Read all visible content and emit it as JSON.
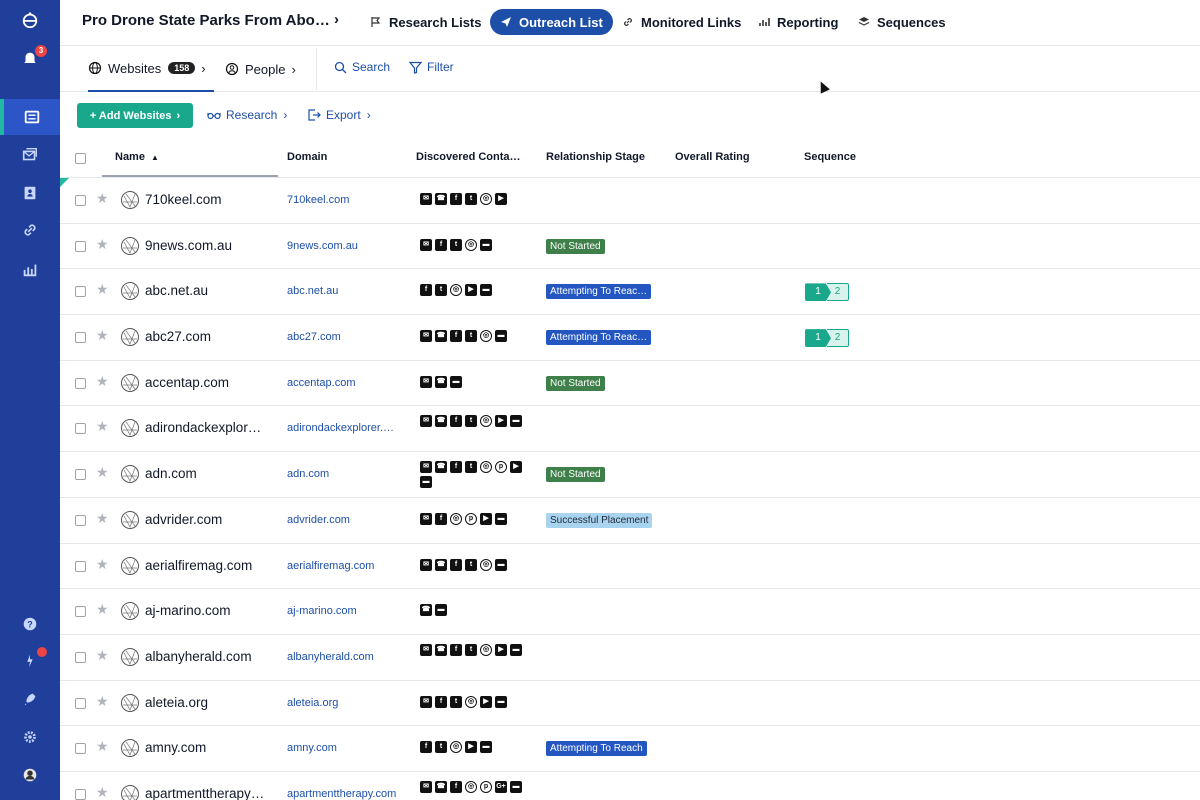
{
  "rail": {
    "notification_count": "3"
  },
  "topbar": {
    "project_title": "Pro Drone State Parks From Abo…",
    "nav": [
      {
        "label": "Research Lists",
        "icon": "flag-icon"
      },
      {
        "label": "Outreach List",
        "icon": "send-icon",
        "active": true
      },
      {
        "label": "Monitored Links",
        "icon": "link-icon"
      },
      {
        "label": "Reporting",
        "icon": "bar-chart-icon"
      },
      {
        "label": "Sequences",
        "icon": "layers-icon"
      }
    ]
  },
  "subbar": {
    "websites_label": "Websites",
    "websites_count": "158",
    "people_label": "People",
    "search_label": "Search",
    "filter_label": "Filter"
  },
  "actions": {
    "add_websites": "+ Add Websites",
    "research": "Research",
    "export": "Export"
  },
  "table": {
    "columns": [
      "Name",
      "Domain",
      "Discovered Conta…",
      "Relationship Stage",
      "Overall Rating",
      "Sequence"
    ],
    "sort_indicator": "▲",
    "rows": [
      {
        "name": "710keel.com",
        "domain": "710keel.com",
        "contacts": [
          "email",
          "phone",
          "facebook",
          "twitter",
          "instagram",
          "youtube"
        ],
        "stage": "",
        "stage_type": "",
        "seq": null
      },
      {
        "name": "9news.com.au",
        "domain": "9news.com.au",
        "contacts": [
          "email",
          "facebook",
          "twitter",
          "instagram",
          "form"
        ],
        "stage": "Not Started",
        "stage_type": "not-started",
        "seq": null
      },
      {
        "name": "abc.net.au",
        "domain": "abc.net.au",
        "contacts": [
          "facebook",
          "twitter",
          "instagram",
          "youtube",
          "form"
        ],
        "stage": "Attempting To Reac…",
        "stage_type": "attempting",
        "seq": [
          "1",
          "2"
        ]
      },
      {
        "name": "abc27.com",
        "domain": "abc27.com",
        "contacts": [
          "email",
          "phone",
          "facebook",
          "twitter",
          "instagram",
          "form"
        ],
        "stage": "Attempting To Reac…",
        "stage_type": "attempting",
        "seq": [
          "1",
          "2"
        ]
      },
      {
        "name": "accentap.com",
        "domain": "accentap.com",
        "contacts": [
          "email",
          "phone",
          "form"
        ],
        "stage": "Not Started",
        "stage_type": "not-started",
        "seq": null
      },
      {
        "name": "adirondackexplor…",
        "domain": "adirondackexplorer.…",
        "contacts": [
          "email",
          "phone",
          "facebook",
          "twitter",
          "instagram",
          "youtube",
          "form"
        ],
        "stage": "",
        "stage_type": "",
        "seq": null
      },
      {
        "name": "adn.com",
        "domain": "adn.com",
        "contacts": [
          "email",
          "phone",
          "facebook",
          "twitter",
          "instagram",
          "pinterest",
          "youtube",
          "form"
        ],
        "stage": "Not Started",
        "stage_type": "not-started",
        "seq": null
      },
      {
        "name": "advrider.com",
        "domain": "advrider.com",
        "contacts": [
          "email",
          "facebook",
          "instagram",
          "pinterest",
          "youtube",
          "form"
        ],
        "stage": "Successful Placement",
        "stage_type": "success",
        "seq": null
      },
      {
        "name": "aerialfiremag.com",
        "domain": "aerialfiremag.com",
        "contacts": [
          "email",
          "phone",
          "facebook",
          "twitter",
          "instagram",
          "form"
        ],
        "stage": "",
        "stage_type": "",
        "seq": null
      },
      {
        "name": "aj-marino.com",
        "domain": "aj-marino.com",
        "contacts": [
          "phone",
          "form"
        ],
        "stage": "",
        "stage_type": "",
        "seq": null
      },
      {
        "name": "albanyherald.com",
        "domain": "albanyherald.com",
        "contacts": [
          "email",
          "phone",
          "facebook",
          "twitter",
          "instagram",
          "youtube",
          "form"
        ],
        "stage": "",
        "stage_type": "",
        "seq": null
      },
      {
        "name": "aleteia.org",
        "domain": "aleteia.org",
        "contacts": [
          "email",
          "facebook",
          "twitter",
          "instagram",
          "youtube",
          "form"
        ],
        "stage": "",
        "stage_type": "",
        "seq": null
      },
      {
        "name": "amny.com",
        "domain": "amny.com",
        "contacts": [
          "facebook",
          "twitter",
          "instagram",
          "youtube",
          "form"
        ],
        "stage": "Attempting To Reach",
        "stage_type": "attempting",
        "seq": null
      },
      {
        "name": "apartmenttherapy…",
        "domain": "apartmenttherapy.com",
        "contacts": [
          "email",
          "phone",
          "facebook",
          "instagram",
          "pinterest",
          "google-plus",
          "form"
        ],
        "stage": "",
        "stage_type": "",
        "seq": null
      }
    ]
  }
}
